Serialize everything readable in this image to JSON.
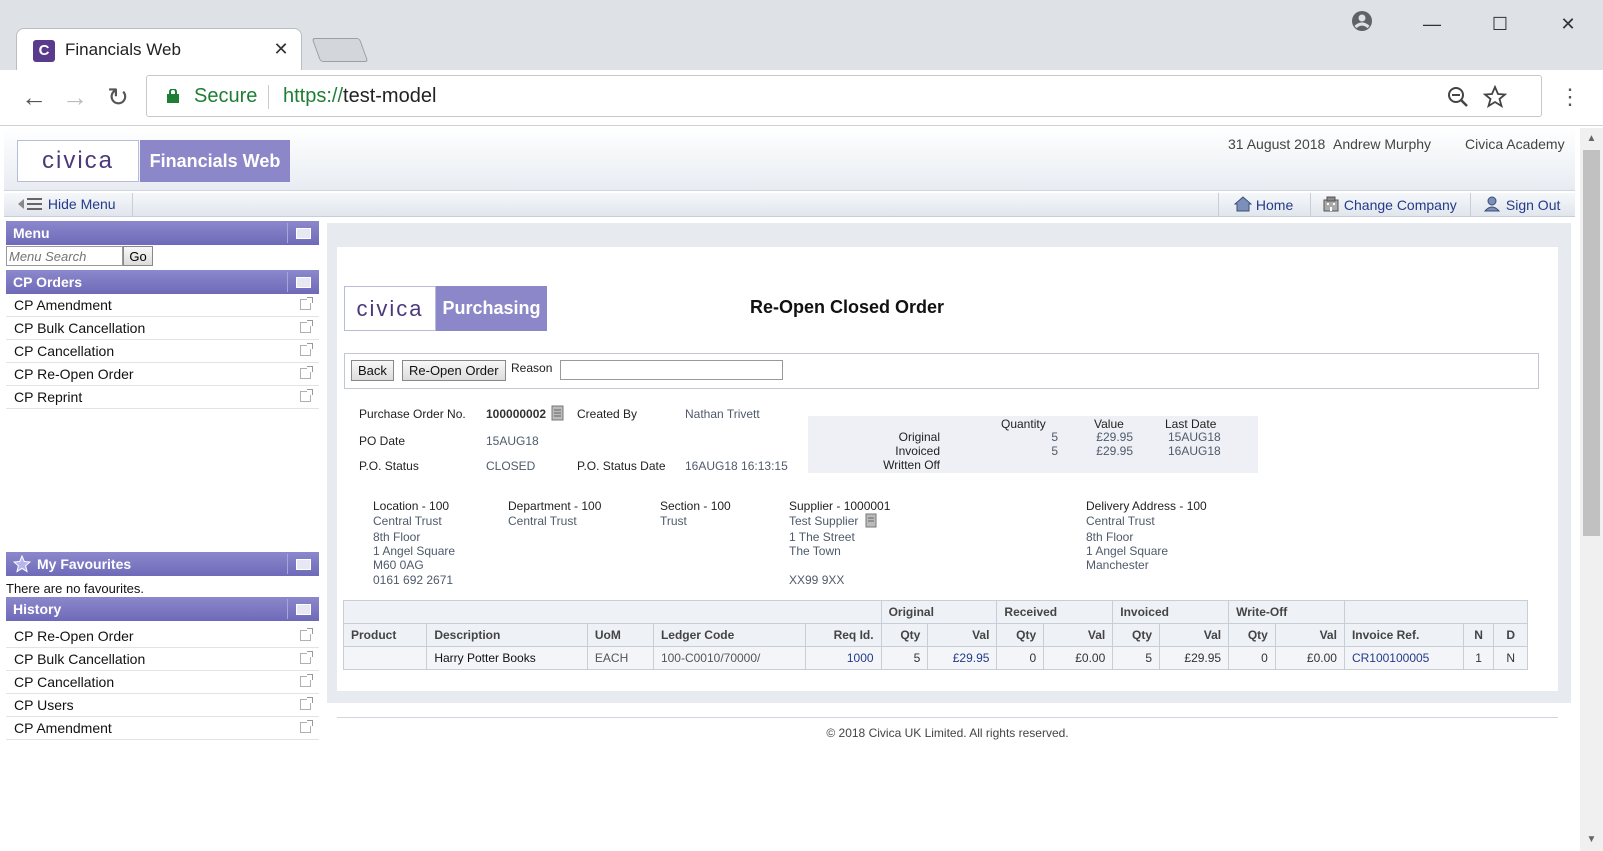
{
  "browser": {
    "tab_title": "Financials Web",
    "tab_favicon": "C",
    "secure_label": "Secure",
    "url_scheme": "https://",
    "url_host": "test-model"
  },
  "header": {
    "logo_brand": "civica",
    "logo_product": "Financials Web",
    "date": "31 August 2018",
    "user": "Andrew Murphy",
    "company": "Civica Academy"
  },
  "menubar": {
    "hide_menu": "Hide Menu",
    "home": "Home",
    "change_company": "Change Company",
    "sign_out": "Sign Out"
  },
  "sidebar": {
    "menu_title": "Menu",
    "search_placeholder": "Menu Search",
    "go_label": "Go",
    "cp_orders_title": "CP Orders",
    "cp_orders_items": [
      "CP Amendment",
      "CP Bulk Cancellation",
      "CP Cancellation",
      "CP Re-Open Order",
      "CP Reprint"
    ],
    "favourites_title": "My Favourites",
    "favourites_empty": "There are no favourites.",
    "history_title": "History",
    "history_items": [
      "CP Re-Open Order",
      "CP Bulk Cancellation",
      "CP Cancellation",
      "CP Users",
      "CP Amendment"
    ]
  },
  "page": {
    "logo_brand": "civica",
    "logo_product": "Purchasing",
    "title": "Re-Open Closed Order",
    "back_label": "Back",
    "reopen_label": "Re-Open Order",
    "reason_label": "Reason",
    "reason_value": ""
  },
  "order": {
    "po_no_label": "Purchase Order No.",
    "po_no": "100000002",
    "created_by_label": "Created By",
    "created_by": "Nathan Trivett",
    "po_date_label": "PO Date",
    "po_date": "15AUG18",
    "status_label": "P.O. Status",
    "status": "CLOSED",
    "status_date_label": "P.O. Status Date",
    "status_date": "16AUG18 16:13:15"
  },
  "summary": {
    "headers": [
      "Quantity",
      "Value",
      "Last Date"
    ],
    "rows": [
      {
        "label": "Original",
        "qty": "5",
        "value": "£29.95",
        "date": "15AUG18"
      },
      {
        "label": "Invoiced",
        "qty": "5",
        "value": "£29.95",
        "date": "16AUG18"
      },
      {
        "label": "Written Off",
        "qty": "",
        "value": "",
        "date": ""
      }
    ]
  },
  "addresses": {
    "location_title": "Location - 100",
    "location_lines": [
      "Central Trust",
      "8th Floor",
      "1 Angel Square",
      "M60 0AG",
      "0161 692 2671"
    ],
    "department_title": "Department - 100",
    "department_lines": [
      "Central Trust"
    ],
    "section_title": "Section - 100",
    "section_lines": [
      "Trust"
    ],
    "supplier_title": "Supplier - 1000001",
    "supplier_lines": [
      "Test Supplier",
      "1 The Street",
      "The Town",
      "",
      "XX99 9XX"
    ],
    "delivery_title": "Delivery Address - 100",
    "delivery_lines": [
      "Central Trust",
      "8th Floor",
      "1 Angel Square",
      "Manchester"
    ]
  },
  "lines_table": {
    "group_headers": [
      "Original",
      "Received",
      "Invoiced",
      "Write-Off"
    ],
    "columns": [
      "Product",
      "Description",
      "UoM",
      "Ledger Code",
      "Req Id.",
      "Qty",
      "Val",
      "Qty",
      "Val",
      "Qty",
      "Val",
      "Qty",
      "Val",
      "Invoice Ref.",
      "N",
      "D"
    ],
    "rows": [
      [
        "",
        "Harry Potter Books",
        "EACH",
        "100-C0010/70000/",
        "1000",
        "5",
        "£29.95",
        "0",
        "£0.00",
        "5",
        "£29.95",
        "0",
        "£0.00",
        "CR100100005",
        "1",
        "N"
      ]
    ]
  },
  "footer": "© 2018 Civica UK Limited. All rights reserved.",
  "colors": {
    "brand_purple": "#8b87c9",
    "link_blue": "#233b8a",
    "secure_green": "#1e7e34"
  }
}
